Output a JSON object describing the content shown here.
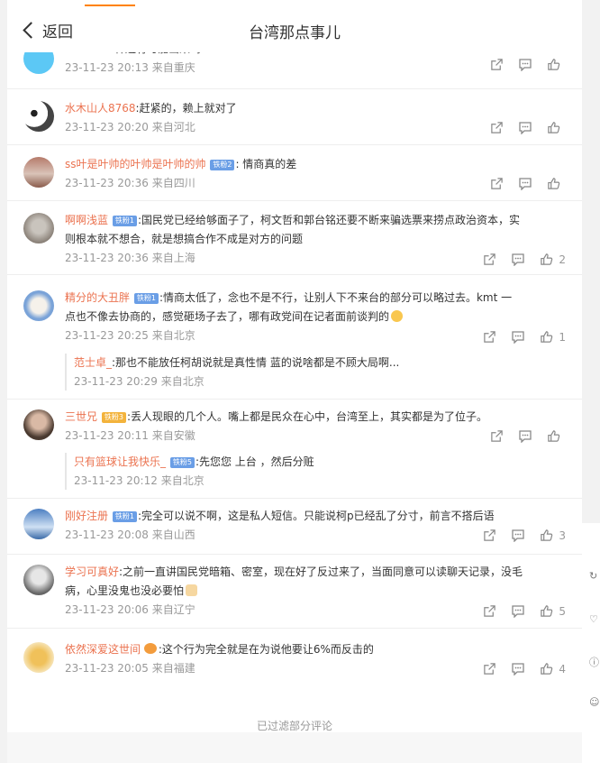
{
  "header": {
    "back_label": "返回",
    "title": "台湾那点事儿"
  },
  "comments": [
    {
      "user": "Airiri518",
      "text": ":韩还有可能出来吗",
      "time": "23-11-23 20:13",
      "loc": "来自重庆",
      "likes": ""
    },
    {
      "user": "水木山人8768",
      "text": ":赶紧的，赖上就对了",
      "time": "23-11-23 20:20",
      "loc": "来自河北",
      "likes": ""
    },
    {
      "user": "ss叶是叶帅的叶帅是叶帅的帅",
      "badge": "铁粉2",
      "text": ": 情商真的差",
      "time": "23-11-23 20:36",
      "loc": "来自四川",
      "likes": ""
    },
    {
      "user": "啊啊浅蓝",
      "badge": "铁粉1",
      "text1": ":国民党已经给够面子了，柯文哲和郭台铭还要不断来骗选票来捞点政治资本，实",
      "text2": "则根本就不想合，就是想搞合作不成是对方的问题",
      "time": "23-11-23 20:36",
      "loc": "来自上海",
      "likes": "2"
    },
    {
      "user": "精分的大丑胖",
      "badge": "铁粉1",
      "text1": ":情商太低了，念也不是不行，让别人下不来台的部分可以略过去。kmt 一",
      "text2": "点也不像去协商的，感觉砸场子去了，哪有政党间在记者面前谈判的",
      "time": "23-11-23 20:25",
      "loc": "来自北京",
      "likes": "1",
      "reply": {
        "user": "范士卓_",
        "text": ":那也不能放任柯胡说就是真性情 蓝的说啥都是不顾大局啊...",
        "time": "23-11-23 20:29",
        "loc": "来自北京"
      }
    },
    {
      "user": "三世兄",
      "badge": "铁粉3",
      "text": ":丢人现眼的几个人。嘴上都是民众在心中，台湾至上，其实都是为了位子。",
      "time": "23-11-23 20:11",
      "loc": "来自安徽",
      "likes": "",
      "reply": {
        "user": "只有篮球让我快乐_",
        "badge": "铁粉5",
        "text": ":先您您 上台 ，然后分赃",
        "time": "23-11-23 20:12",
        "loc": "来自北京"
      }
    },
    {
      "user": "刚好注册",
      "badge": "铁粉1",
      "text": ":完全可以说不啊，这是私人短信。只能说柯p已经乱了分寸，前言不搭后语",
      "time": "23-11-23 20:08",
      "loc": "来自山西",
      "likes": "3"
    },
    {
      "user": "学习可真好",
      "text1": ":之前一直讲国民党暗箱、密室，现在好了反过来了，当面同意可以读聊天记录，没毛",
      "text2": "病，心里没鬼也没必要怕",
      "time": "23-11-23 20:06",
      "loc": "来自辽宁",
      "likes": "5"
    },
    {
      "user": "依然深爱这世间",
      "text": ":这个行为完全就是在为说他要让6%而反击的",
      "time": "23-11-23 20:05",
      "loc": "来自福建",
      "likes": "4"
    }
  ],
  "footer": {
    "note": "已过滤部分评论"
  },
  "colors": {
    "username": "#eb7350",
    "accent": "#ff8200",
    "badge": "#6a9ee6"
  },
  "icons": [
    "share-icon",
    "comment-icon",
    "like-icon",
    "back-chevron-icon"
  ]
}
